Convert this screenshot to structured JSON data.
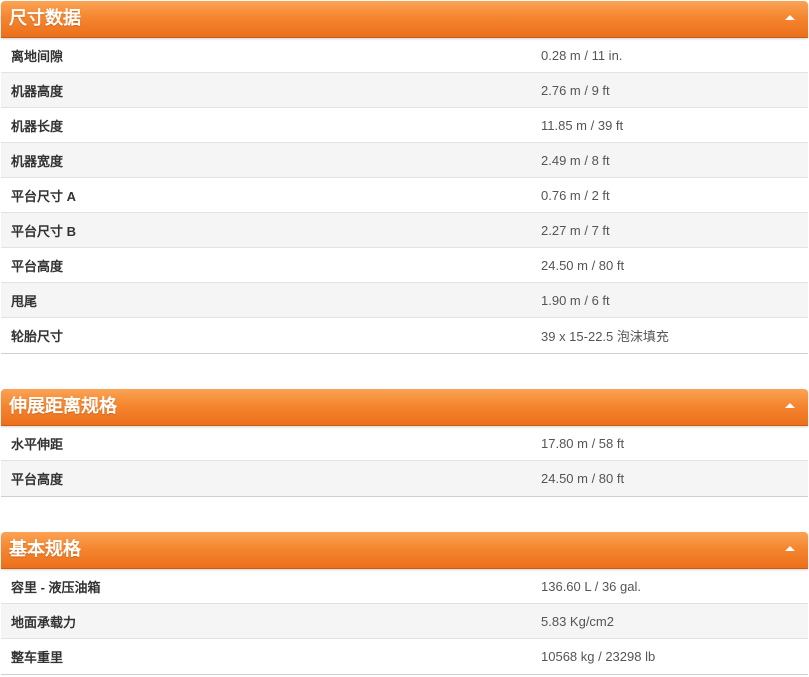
{
  "colors": {
    "header_top": "#fba355",
    "header_mid": "#f5862f",
    "header_bottom": "#ec6f1c",
    "row_alt": "#f5f5f5"
  },
  "icons": {
    "toggle": "caret-up-icon"
  },
  "sections": [
    {
      "title": "尺寸数据",
      "rows": [
        {
          "label": "离地间隙",
          "value": "0.28 m / 11 in."
        },
        {
          "label": "机器高度",
          "value": "2.76 m / 9 ft"
        },
        {
          "label": "机器长度",
          "value": "11.85 m / 39 ft"
        },
        {
          "label": "机器宽度",
          "value": "2.49 m / 8 ft"
        },
        {
          "label": "平台尺寸 A",
          "value": "0.76 m / 2 ft"
        },
        {
          "label": "平台尺寸 B",
          "value": "2.27 m / 7 ft"
        },
        {
          "label": "平台高度",
          "value": "24.50 m / 80 ft"
        },
        {
          "label": "甩尾",
          "value": "1.90 m / 6 ft"
        },
        {
          "label": "轮胎尺寸",
          "value": "39 x 15-22.5 泡沫填充"
        }
      ]
    },
    {
      "title": "伸展距离规格",
      "rows": [
        {
          "label": "水平伸距",
          "value": "17.80 m / 58 ft"
        },
        {
          "label": "平台高度",
          "value": "24.50 m / 80 ft"
        }
      ]
    },
    {
      "title": "基本规格",
      "rows": [
        {
          "label": "容里 - 液压油箱",
          "value": "136.60 L / 36 gal."
        },
        {
          "label": "地面承载力",
          "value": "5.83 Kg/cm2"
        },
        {
          "label": "整车重里",
          "value": "10568 kg / 23298 lb"
        }
      ]
    }
  ]
}
